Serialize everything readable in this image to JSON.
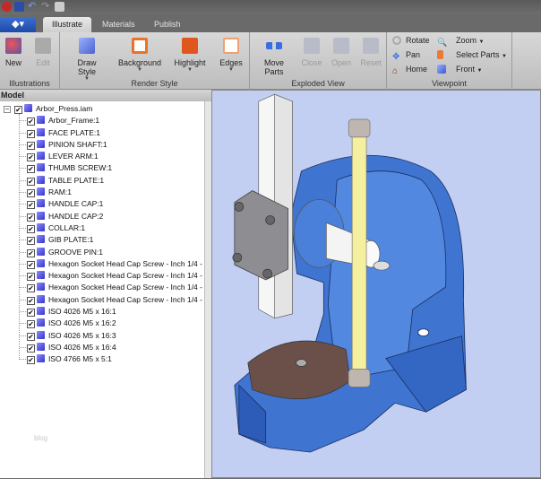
{
  "quick_access": [
    "app-icon",
    "save-icon",
    "undo-icon",
    "redo-icon",
    "print-icon"
  ],
  "tabs": [
    {
      "label": "Illustrate",
      "active": true
    },
    {
      "label": "Materials"
    },
    {
      "label": "Publish"
    }
  ],
  "ribbon": {
    "illustrations": {
      "label": "Illustrations",
      "new": "New",
      "edit": "Edit"
    },
    "render_style": {
      "label": "Render Style",
      "draw_style": "Draw Style",
      "background": "Background",
      "highlight": "Highlight",
      "edges": "Edges"
    },
    "exploded_view": {
      "label": "Exploded View",
      "move_parts": "Move Parts",
      "close": "Close",
      "open": "Open",
      "reset": "Reset"
    },
    "viewpoint": {
      "label": "Viewpoint",
      "rotate": "Rotate",
      "pan": "Pan",
      "home": "Home",
      "zoom": "Zoom",
      "select_parts": "Select Parts",
      "front": "Front"
    }
  },
  "model_panel": {
    "title": "Model",
    "root": "Arbor_Press.iam",
    "items": [
      "Arbor_Frame:1",
      "FACE PLATE:1",
      "PINION SHAFT:1",
      "LEVER ARM:1",
      "THUMB SCREW:1",
      "TABLE PLATE:1",
      "RAM:1",
      "HANDLE CAP:1",
      "HANDLE CAP:2",
      "COLLAR:1",
      "GIB PLATE:1",
      "GROOVE PIN:1",
      "Hexagon Socket Head Cap Screw - Inch 1/4 -",
      "Hexagon Socket Head Cap Screw - Inch 1/4 -",
      "Hexagon Socket Head Cap Screw - Inch 1/4 -",
      "Hexagon Socket Head Cap Screw - Inch 1/4 -",
      "ISO 4026 M5 x 16:1",
      "ISO 4026 M5 x 16:2",
      "ISO 4026 M5 x 16:3",
      "ISO 4026 M5 x 16:4",
      "ISO 4766 M5 x 5:1"
    ]
  },
  "watermark": "blog",
  "colors": {
    "viewport_bg": "#c3cff2",
    "frame_blue": "#3f74d0",
    "rod_yellow": "#f4f0a0"
  }
}
